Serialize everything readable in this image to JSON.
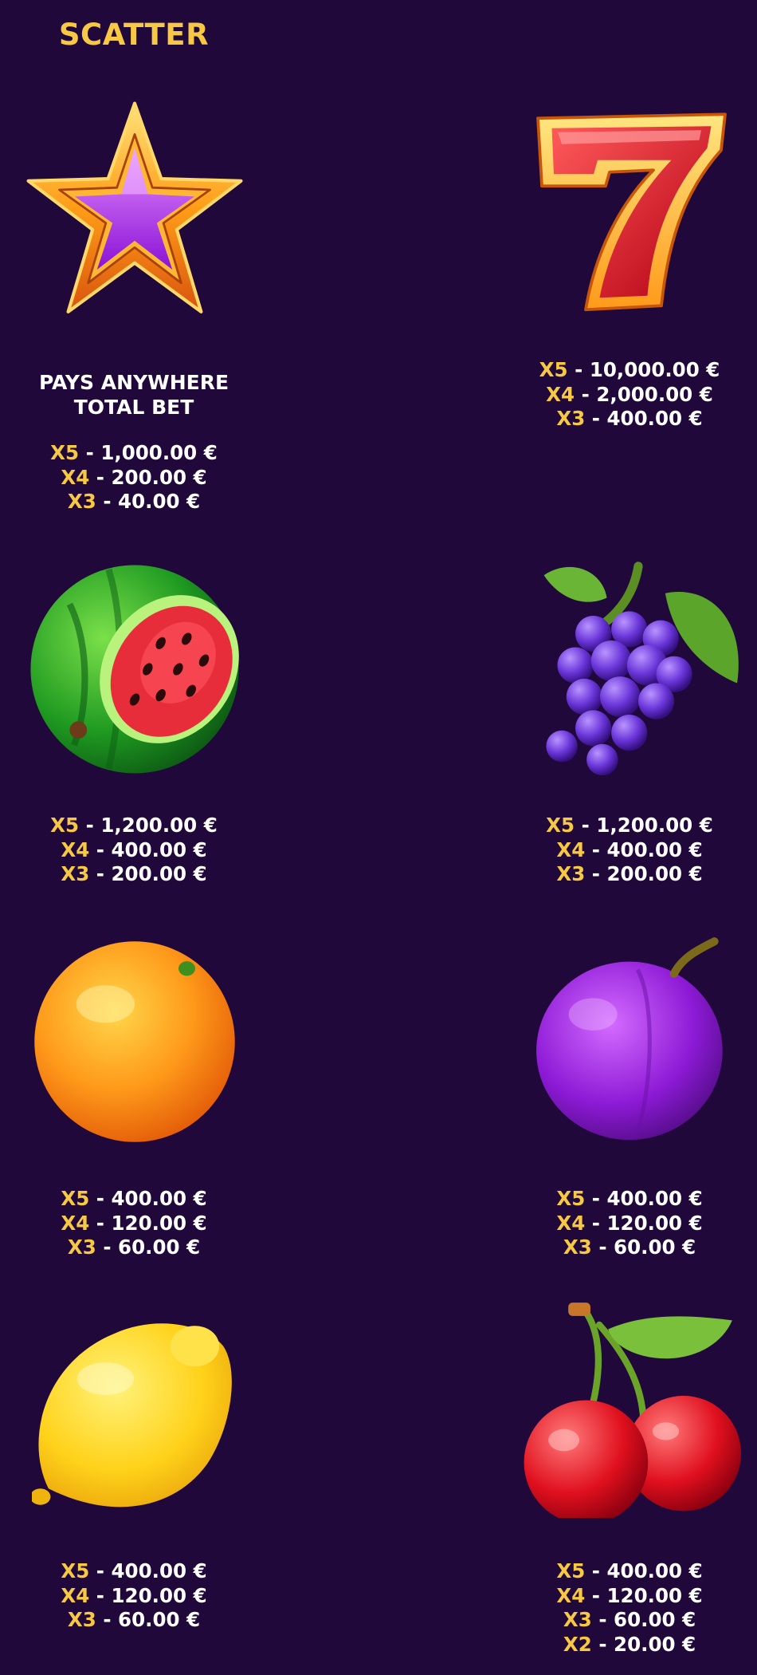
{
  "page": {
    "background": "#21083a",
    "accent": "#f7c843"
  },
  "scatter": {
    "title": "SCATTER",
    "description": "PAYS ANYWHERE TOTAL BET",
    "pays": [
      {
        "mult": "X5",
        "amount": " - 1,000.00 €"
      },
      {
        "mult": "X4",
        "amount": " - 200.00 €"
      },
      {
        "mult": "X3",
        "amount": " - 40.00 €"
      }
    ]
  },
  "symbols": {
    "seven": {
      "icon": "seven-icon",
      "pays": [
        {
          "mult": "X5",
          "amount": " - 10,000.00 €"
        },
        {
          "mult": "X4",
          "amount": " - 2,000.00 €"
        },
        {
          "mult": "X3",
          "amount": " - 400.00 €"
        }
      ]
    },
    "watermelon": {
      "icon": "watermelon-icon",
      "pays": [
        {
          "mult": "X5",
          "amount": " - 1,200.00 €"
        },
        {
          "mult": "X4",
          "amount": " - 400.00 €"
        },
        {
          "mult": "X3",
          "amount": " - 200.00 €"
        }
      ]
    },
    "grapes": {
      "icon": "grapes-icon",
      "pays": [
        {
          "mult": "X5",
          "amount": " - 1,200.00 €"
        },
        {
          "mult": "X4",
          "amount": " - 400.00 €"
        },
        {
          "mult": "X3",
          "amount": " - 200.00 €"
        }
      ]
    },
    "orange": {
      "icon": "orange-icon",
      "pays": [
        {
          "mult": "X5",
          "amount": " - 400.00 €"
        },
        {
          "mult": "X4",
          "amount": " - 120.00 €"
        },
        {
          "mult": "X3",
          "amount": " - 60.00 €"
        }
      ]
    },
    "plum": {
      "icon": "plum-icon",
      "pays": [
        {
          "mult": "X5",
          "amount": " - 400.00 €"
        },
        {
          "mult": "X4",
          "amount": " - 120.00 €"
        },
        {
          "mult": "X3",
          "amount": " - 60.00 €"
        }
      ]
    },
    "lemon": {
      "icon": "lemon-icon",
      "pays": [
        {
          "mult": "X5",
          "amount": " - 400.00 €"
        },
        {
          "mult": "X4",
          "amount": " - 120.00 €"
        },
        {
          "mult": "X3",
          "amount": " - 60.00 €"
        }
      ]
    },
    "cherry": {
      "icon": "cherry-icon",
      "pays": [
        {
          "mult": "X5",
          "amount": " - 400.00 €"
        },
        {
          "mult": "X4",
          "amount": " - 120.00 €"
        },
        {
          "mult": "X3",
          "amount": " - 60.00 €"
        },
        {
          "mult": "X2",
          "amount": " - 20.00 €"
        }
      ]
    }
  }
}
